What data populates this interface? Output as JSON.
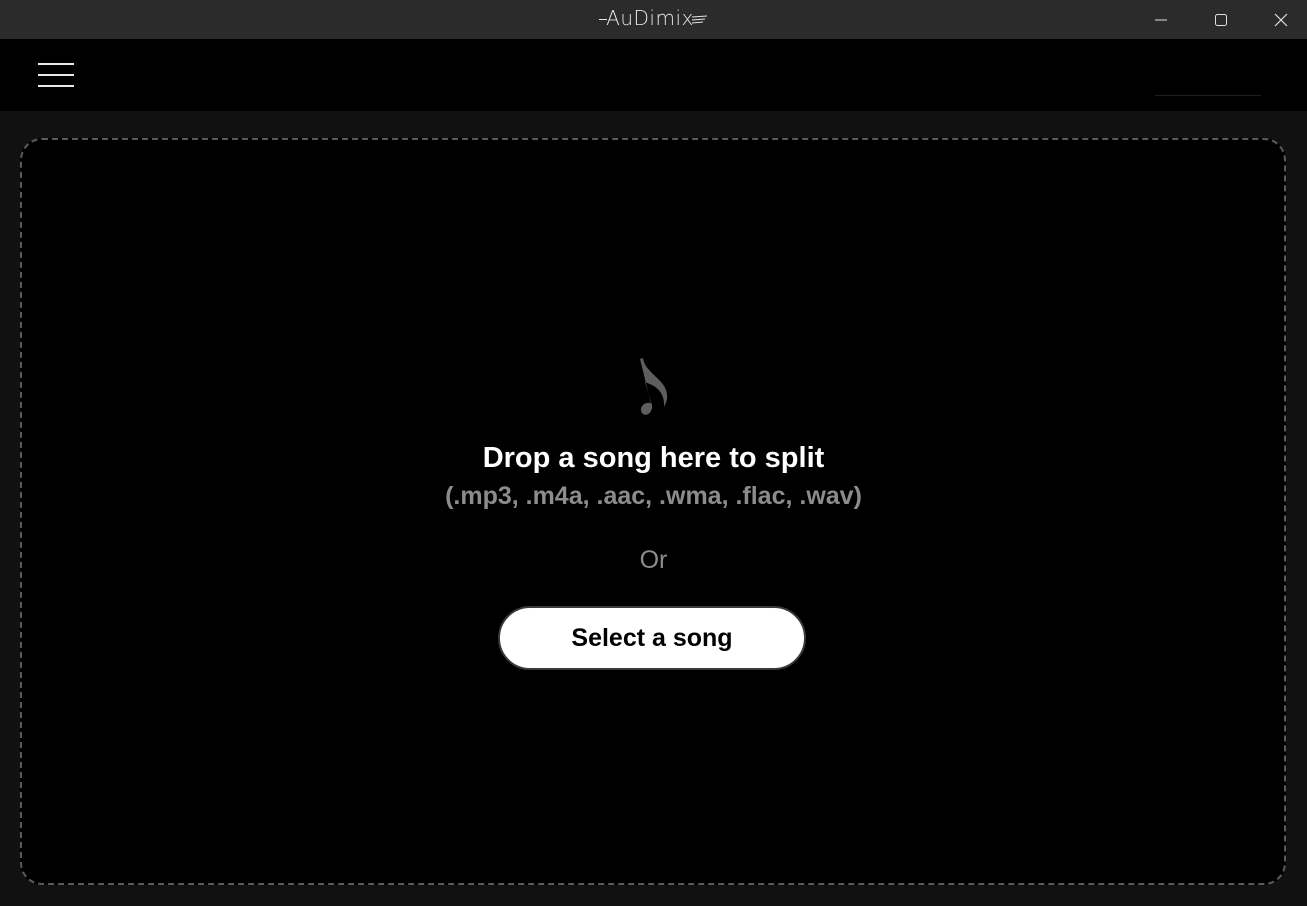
{
  "window": {
    "title": "AuDimix",
    "controls": {
      "minimize": "minimize-icon",
      "maximize": "maximize-icon",
      "close": "close-icon"
    }
  },
  "header": {
    "menu_icon": "hamburger-menu-icon"
  },
  "dropzone": {
    "icon": "music-note-icon",
    "title": "Drop a song here to split",
    "formats": "(.mp3, .m4a, .aac, .wma, .flac, .wav)",
    "or_text": "Or",
    "select_button_label": "Select a song"
  },
  "colors": {
    "titlebar_bg": "#2b2b2b",
    "header_bg": "#000000",
    "page_bg": "#111111",
    "dropzone_bg": "#000000",
    "dropzone_border": "#5a5a5a",
    "muted_text": "#8c8c8c",
    "button_bg": "#ffffff"
  }
}
